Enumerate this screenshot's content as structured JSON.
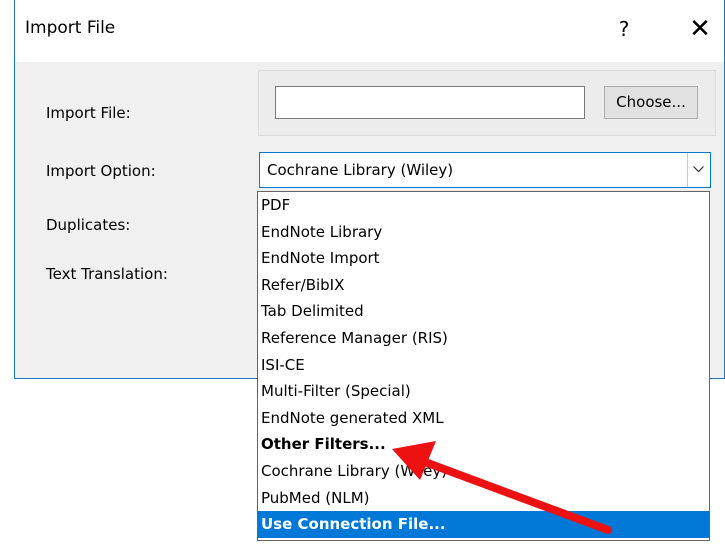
{
  "dialog": {
    "title": "Import File",
    "help_glyph": "?",
    "close_glyph": "✕"
  },
  "form": {
    "import_file_label": "Import File:",
    "import_file_value": "",
    "choose_button": "Choose...",
    "import_option_label": "Import Option:",
    "import_option_value": "Cochrane Library (Wiley)",
    "duplicates_label": "Duplicates:",
    "text_translation_label": "Text Translation:"
  },
  "dropdown": {
    "options": [
      "PDF",
      "EndNote Library",
      "EndNote Import",
      "Refer/BibIX",
      "Tab Delimited",
      "Reference Manager (RIS)",
      "ISI-CE",
      "Multi-Filter (Special)",
      "EndNote generated XML",
      "Other Filters...",
      "Cochrane Library (Wiley)",
      "PubMed (NLM)",
      "Use Connection File..."
    ],
    "bold_option": "Other Filters...",
    "selected_option": "Use Connection File..."
  },
  "colors": {
    "accent": "#0078d7",
    "annotation_arrow": "#ee1111"
  },
  "icons": {
    "combo_toggle": "chevron-down-icon",
    "annotation": "red-arrow-icon"
  }
}
